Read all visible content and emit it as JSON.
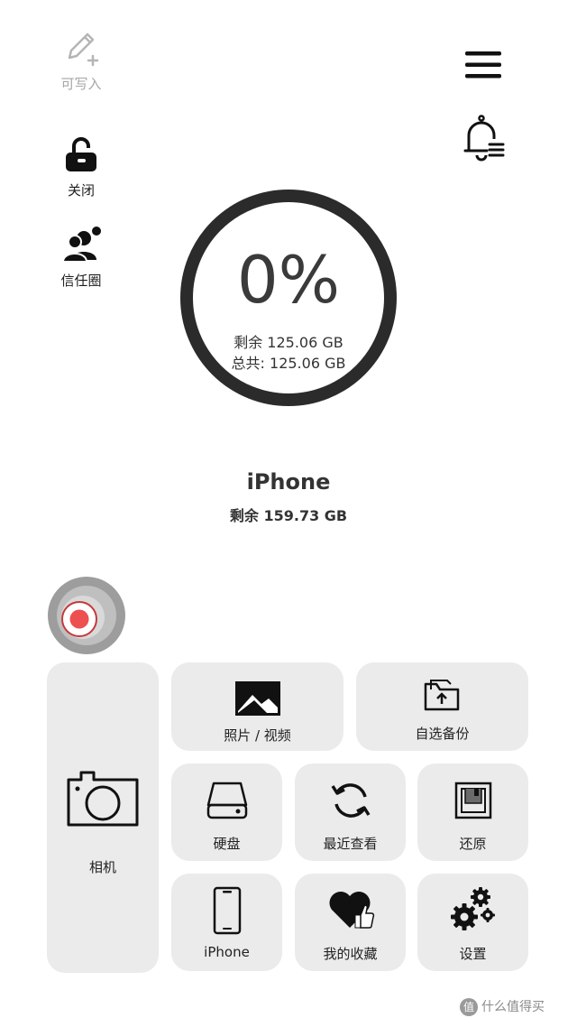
{
  "status": {
    "write": {
      "label": "可写入",
      "icon": "pencil-plus-icon"
    },
    "lock": {
      "label": "关闭",
      "icon": "unlock-icon"
    },
    "trust": {
      "label": "信任圈",
      "icon": "users-icon"
    }
  },
  "header": {
    "menu_icon": "hamburger-menu-icon",
    "bell_icon": "notification-bell-icon"
  },
  "storage": {
    "percent_label": "0%",
    "used_fraction": 0.0,
    "remaining_text": "剩余 125.06 GB",
    "total_text": "总共: 125.06 GB"
  },
  "device": {
    "name": "iPhone",
    "remaining_text": "剩余 159.73 GB"
  },
  "tiles": {
    "camera": {
      "label": "相机",
      "icon": "camera-icon"
    },
    "photos": {
      "label": "照片 / 视频",
      "icon": "photo-icon"
    },
    "backup": {
      "label": "自选备份",
      "icon": "folder-upload-icon"
    },
    "disk": {
      "label": "硬盘",
      "icon": "hard-drive-icon"
    },
    "recent": {
      "label": "最近查看",
      "icon": "refresh-icon"
    },
    "restore": {
      "label": "还原",
      "icon": "restore-box-icon"
    },
    "iphone": {
      "label": "iPhone",
      "icon": "phone-icon"
    },
    "favorites": {
      "label": "我的收藏",
      "icon": "heart-thumb-icon"
    },
    "settings": {
      "label": "设置",
      "icon": "gears-icon"
    }
  },
  "watermark": {
    "text": "什么值得买",
    "logo": "值"
  },
  "colors": {
    "ring": "#2b2b2b",
    "tile_bg": "#ebebeb",
    "record_red": "#ec5050"
  }
}
